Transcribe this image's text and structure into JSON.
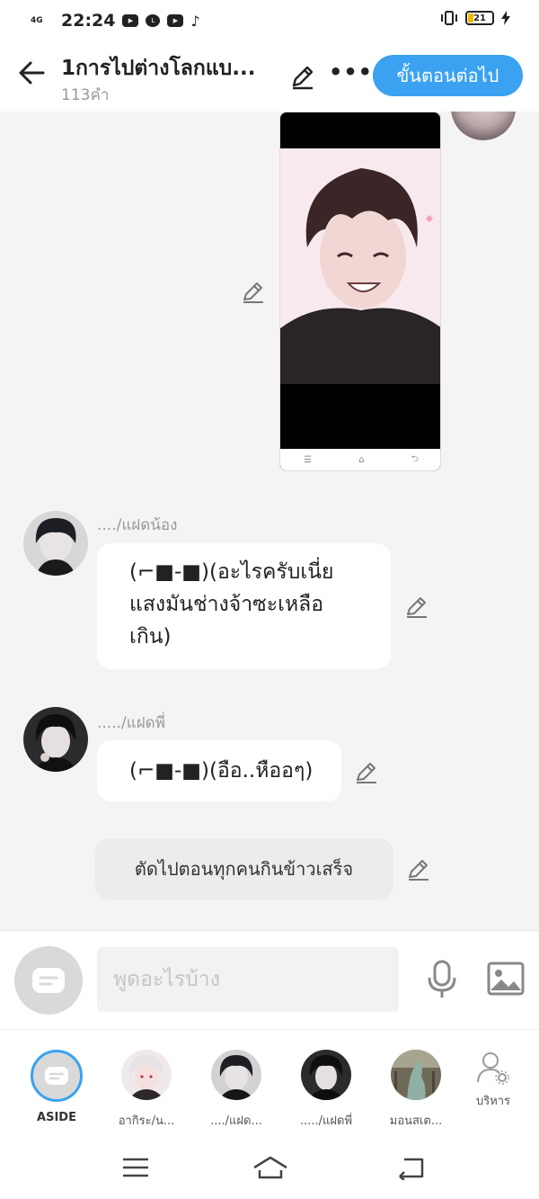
{
  "status_bar": {
    "network": "4G",
    "time": "22:24",
    "battery": "21",
    "app_icons": [
      "youtube-icon",
      "line-icon",
      "play-icon",
      "tiktok-icon"
    ]
  },
  "header": {
    "title": "1การไปต่างโลกแบ...",
    "word_count": "113คำ",
    "next_label": "ขั้นตอนต่อไป"
  },
  "messages": [
    {
      "name": "..../แฝดน้อง",
      "text_lines": [
        "(⌐■-■)(อะไรครับเนี่ย",
        "แสงมันช่างจ้าซะเหลือ",
        "เกิน)"
      ]
    },
    {
      "name": "...../แฝดพี่",
      "text_lines": [
        "(⌐■-■)(อือ..หืออๆ)"
      ]
    }
  ],
  "narration": "ตัดไปตอนทุกคนกินข้าวเสร็จ",
  "composer": {
    "placeholder": "พูดอะไรบ้าง"
  },
  "characters": [
    {
      "label": "ASIDE"
    },
    {
      "label": "อากิระ/น..."
    },
    {
      "label": "..../แฝด..."
    },
    {
      "label": "...../แฝดพี่"
    },
    {
      "label": "มอนสเต..."
    },
    {
      "label": "บริหาร"
    }
  ],
  "colors": {
    "accent": "#3aa2f0",
    "background": "#f4f4f4"
  }
}
